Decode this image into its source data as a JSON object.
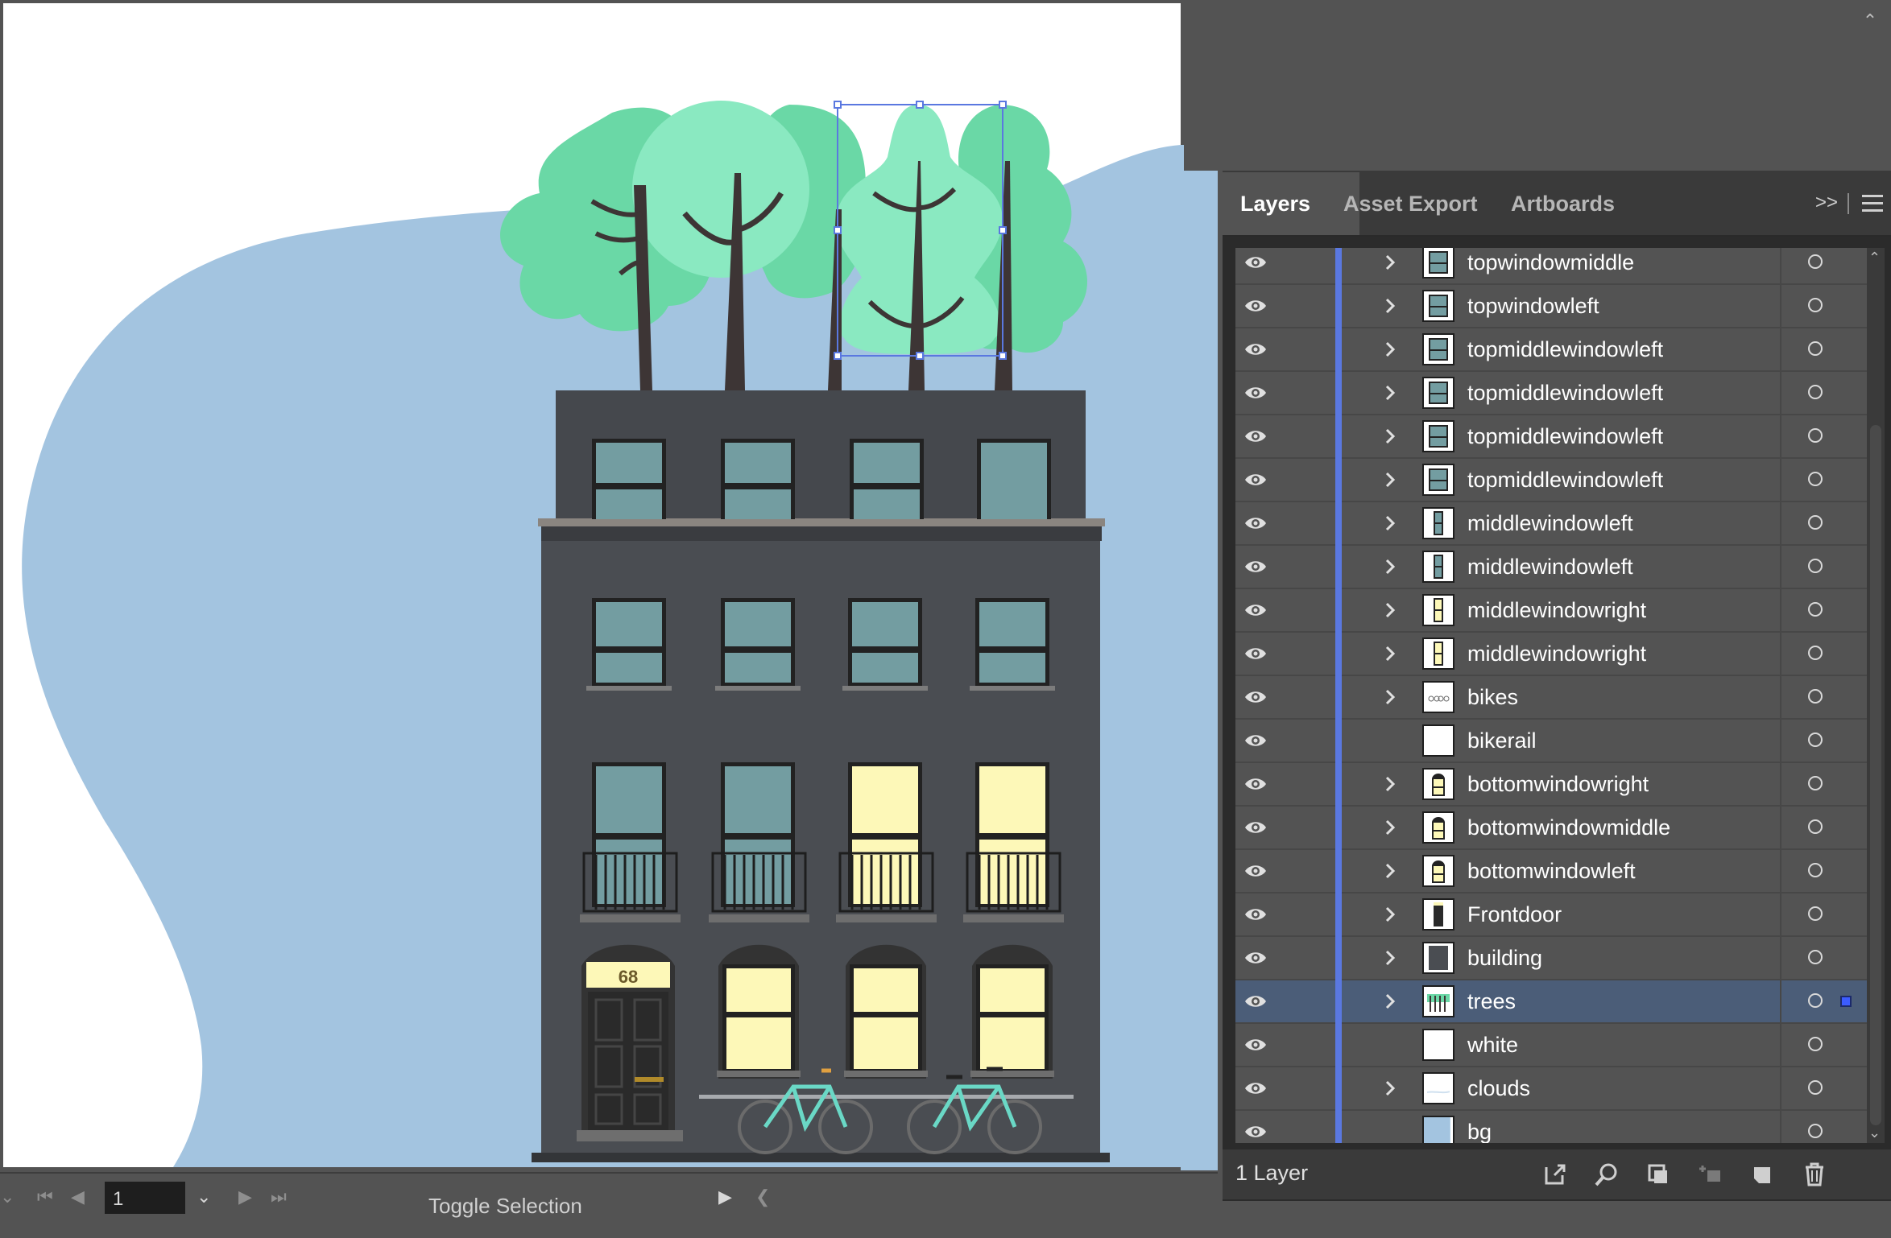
{
  "panel": {
    "tabs": [
      {
        "label": "Layers",
        "active": true
      },
      {
        "label": "Asset Export",
        "active": false
      },
      {
        "label": "Artboards",
        "active": false
      }
    ],
    "collapse_glyph": ">>"
  },
  "layers": [
    {
      "name": "topwindowmiddle",
      "expandable": true,
      "thumb": "window-teal"
    },
    {
      "name": "topwindowleft",
      "expandable": true,
      "thumb": "window-teal"
    },
    {
      "name": "topmiddlewindowleft",
      "expandable": true,
      "thumb": "window-teal"
    },
    {
      "name": "topmiddlewindowleft",
      "expandable": true,
      "thumb": "window-teal"
    },
    {
      "name": "topmiddlewindowleft",
      "expandable": true,
      "thumb": "window-teal"
    },
    {
      "name": "topmiddlewindowleft",
      "expandable": true,
      "thumb": "window-teal"
    },
    {
      "name": "middlewindowleft",
      "expandable": true,
      "thumb": "window-tall-teal"
    },
    {
      "name": "middlewindowleft",
      "expandable": true,
      "thumb": "window-tall-teal"
    },
    {
      "name": "middlewindowright",
      "expandable": true,
      "thumb": "window-tall-yellow"
    },
    {
      "name": "middlewindowright",
      "expandable": true,
      "thumb": "window-tall-yellow"
    },
    {
      "name": "bikes",
      "expandable": true,
      "thumb": "bikes"
    },
    {
      "name": "bikerail",
      "expandable": false,
      "thumb": "blank"
    },
    {
      "name": "bottomwindowright",
      "expandable": true,
      "thumb": "arch-yellow"
    },
    {
      "name": "bottomwindowmiddle",
      "expandable": true,
      "thumb": "arch-yellow"
    },
    {
      "name": "bottomwindowleft",
      "expandable": true,
      "thumb": "arch-yellow"
    },
    {
      "name": "Frontdoor",
      "expandable": true,
      "thumb": "door"
    },
    {
      "name": "building",
      "expandable": true,
      "thumb": "building"
    },
    {
      "name": "trees",
      "expandable": true,
      "thumb": "trees",
      "selected": true
    },
    {
      "name": "white",
      "expandable": false,
      "thumb": "blank"
    },
    {
      "name": "clouds",
      "expandable": true,
      "thumb": "clouds"
    },
    {
      "name": "bg",
      "expandable": false,
      "thumb": "bg"
    }
  ],
  "footer": {
    "layer_count": "1 Layer"
  },
  "status": {
    "artboard_number": "1",
    "toggle_label": "Toggle Selection"
  },
  "artwork": {
    "house_number": "68"
  },
  "colors": {
    "background_blob": "#a3c4e0",
    "building": "#4a4d52",
    "window_teal": "#739da1",
    "window_lit": "#fdf8b8",
    "tree_light": "#8ae9c1",
    "tree_mid": "#6ad8a6",
    "trunk": "#3d3535",
    "layer_color_bar": "#5a78e0",
    "selected_row": "#4b5d78"
  }
}
